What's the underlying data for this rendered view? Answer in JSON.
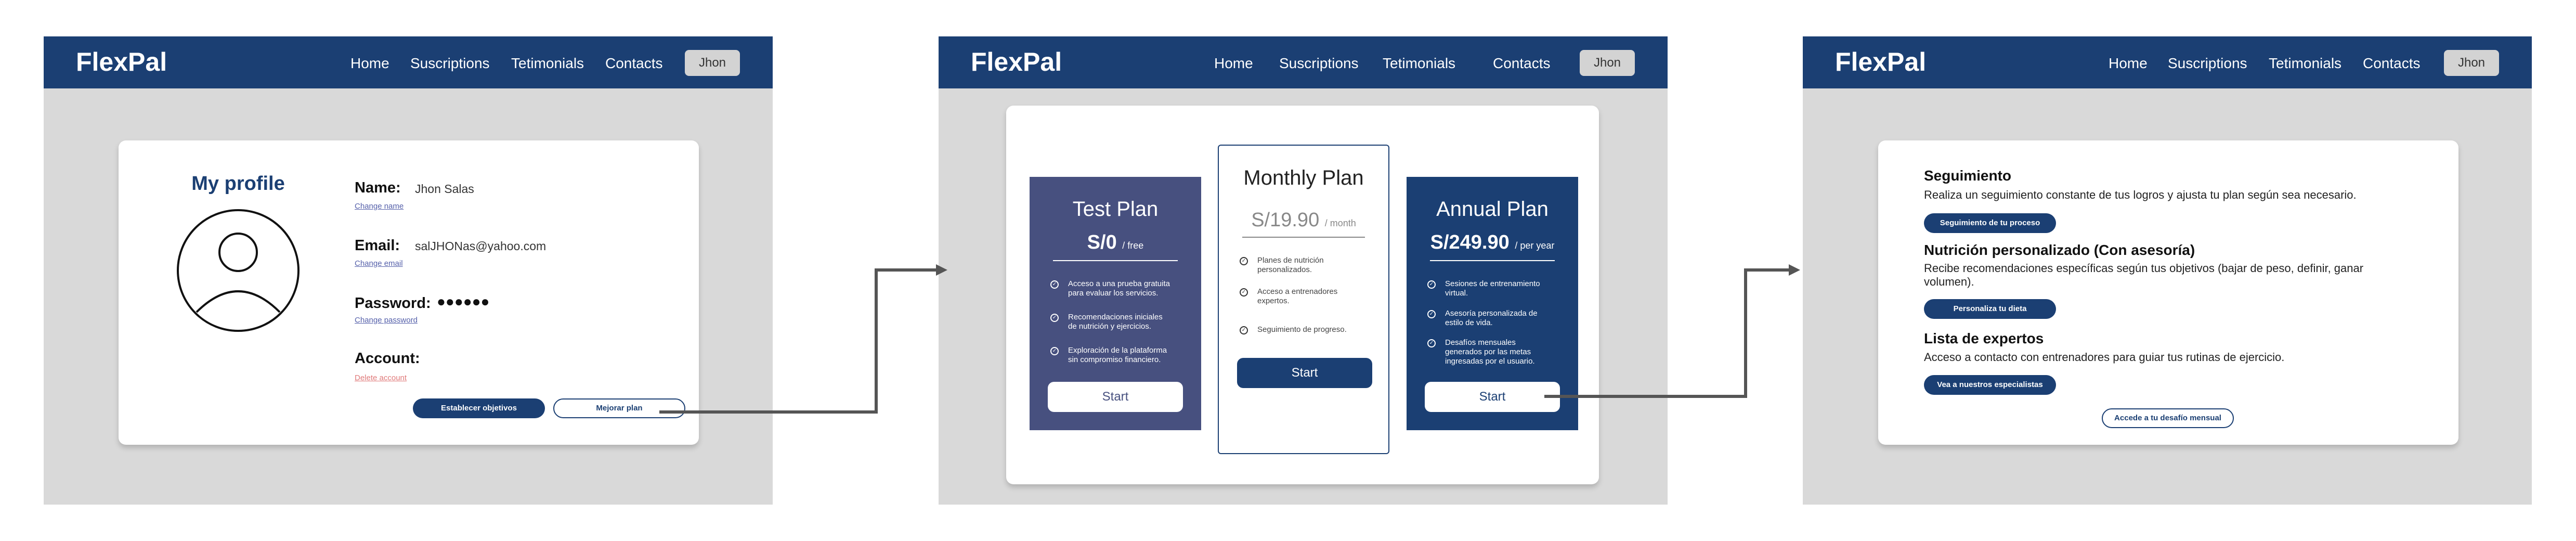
{
  "nav": {
    "brand": "FlexPal",
    "links": [
      "Home",
      "Suscriptions",
      "Tetimonials",
      "Contacts"
    ],
    "user": "Jhon"
  },
  "profile": {
    "title": "My profile",
    "name_label": "Name:",
    "name_value": "Jhon Salas",
    "change_name": "Change name",
    "email_label": "Email:",
    "email_value": "salJHONas@yahoo.com",
    "change_email": "Change email",
    "password_label": "Password:",
    "password_value": "●●●●●●",
    "change_password": "Change password",
    "account_label": "Account:",
    "delete_account": "Delete account",
    "set_goals_button": "Establecer objetivos",
    "upgrade_button": "Mejorar plan"
  },
  "plans": [
    {
      "title": "Test Plan",
      "price": "S/0",
      "period": "/ free",
      "features": [
        "Acceso a una prueba gratuita para evaluar los servicios.",
        "Recomendaciones iniciales de nutrición y ejercicios.",
        "Exploración de la plataforma sin compromiso financiero."
      ],
      "button": "Start"
    },
    {
      "title": "Monthly Plan",
      "price": "S/19.90",
      "period": "/ month",
      "features": [
        "Planes de nutrición personalizados.",
        "Acceso a entrenadores expertos.",
        "Seguimiento de progreso."
      ],
      "button": "Start"
    },
    {
      "title": "Annual Plan",
      "price": "S/249.90",
      "period": "/ per year",
      "features": [
        "Sesiones de entrenamiento virtual.",
        "Asesoría personalizada de estilo de vida.",
        "Desafíos mensuales generados por las metas ingresadas por el usuario."
      ],
      "button": "Start"
    }
  ],
  "services": {
    "tracking_title": "Seguimiento",
    "tracking_desc": "Realiza un seguimiento constante de tus logros y ajusta tu plan según sea necesario.",
    "tracking_button": "Seguimiento de tu proceso",
    "nutrition_title": "Nutrición personalizado (Con asesoría)",
    "nutrition_desc": "Recibe recomendaciones específicas según tus objetivos (bajar de peso, definir, ganar volumen).",
    "nutrition_button": "Personaliza tu dieta",
    "experts_title": "Lista de expertos",
    "experts_desc": "Acceso a contacto con entrenadores para guiar tus rutinas de ejercicio.",
    "experts_button": "Vea a nuestros especialistas",
    "challenge_button": "Accede a tu desafío mensual"
  },
  "colors": {
    "navy": "#1b3f73",
    "slate": "#47507f",
    "frame_bg": "#d9d9d9"
  }
}
